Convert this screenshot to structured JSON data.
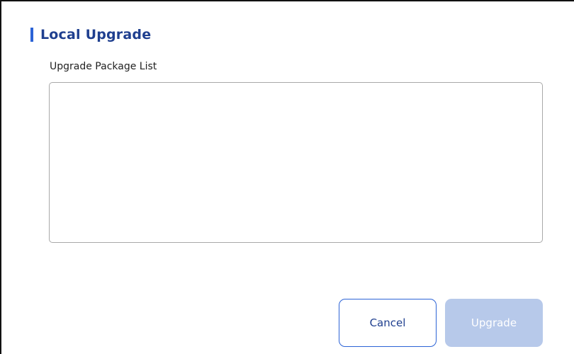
{
  "dialog": {
    "title": "Local Upgrade",
    "package_list_label": "Upgrade Package List",
    "package_list_items": []
  },
  "buttons": {
    "cancel_label": "Cancel",
    "upgrade_label": "Upgrade",
    "upgrade_enabled": false
  },
  "colors": {
    "accent": "#2c63d6",
    "title_text": "#1f3f8f",
    "disabled_button": "#b7c9ea"
  }
}
